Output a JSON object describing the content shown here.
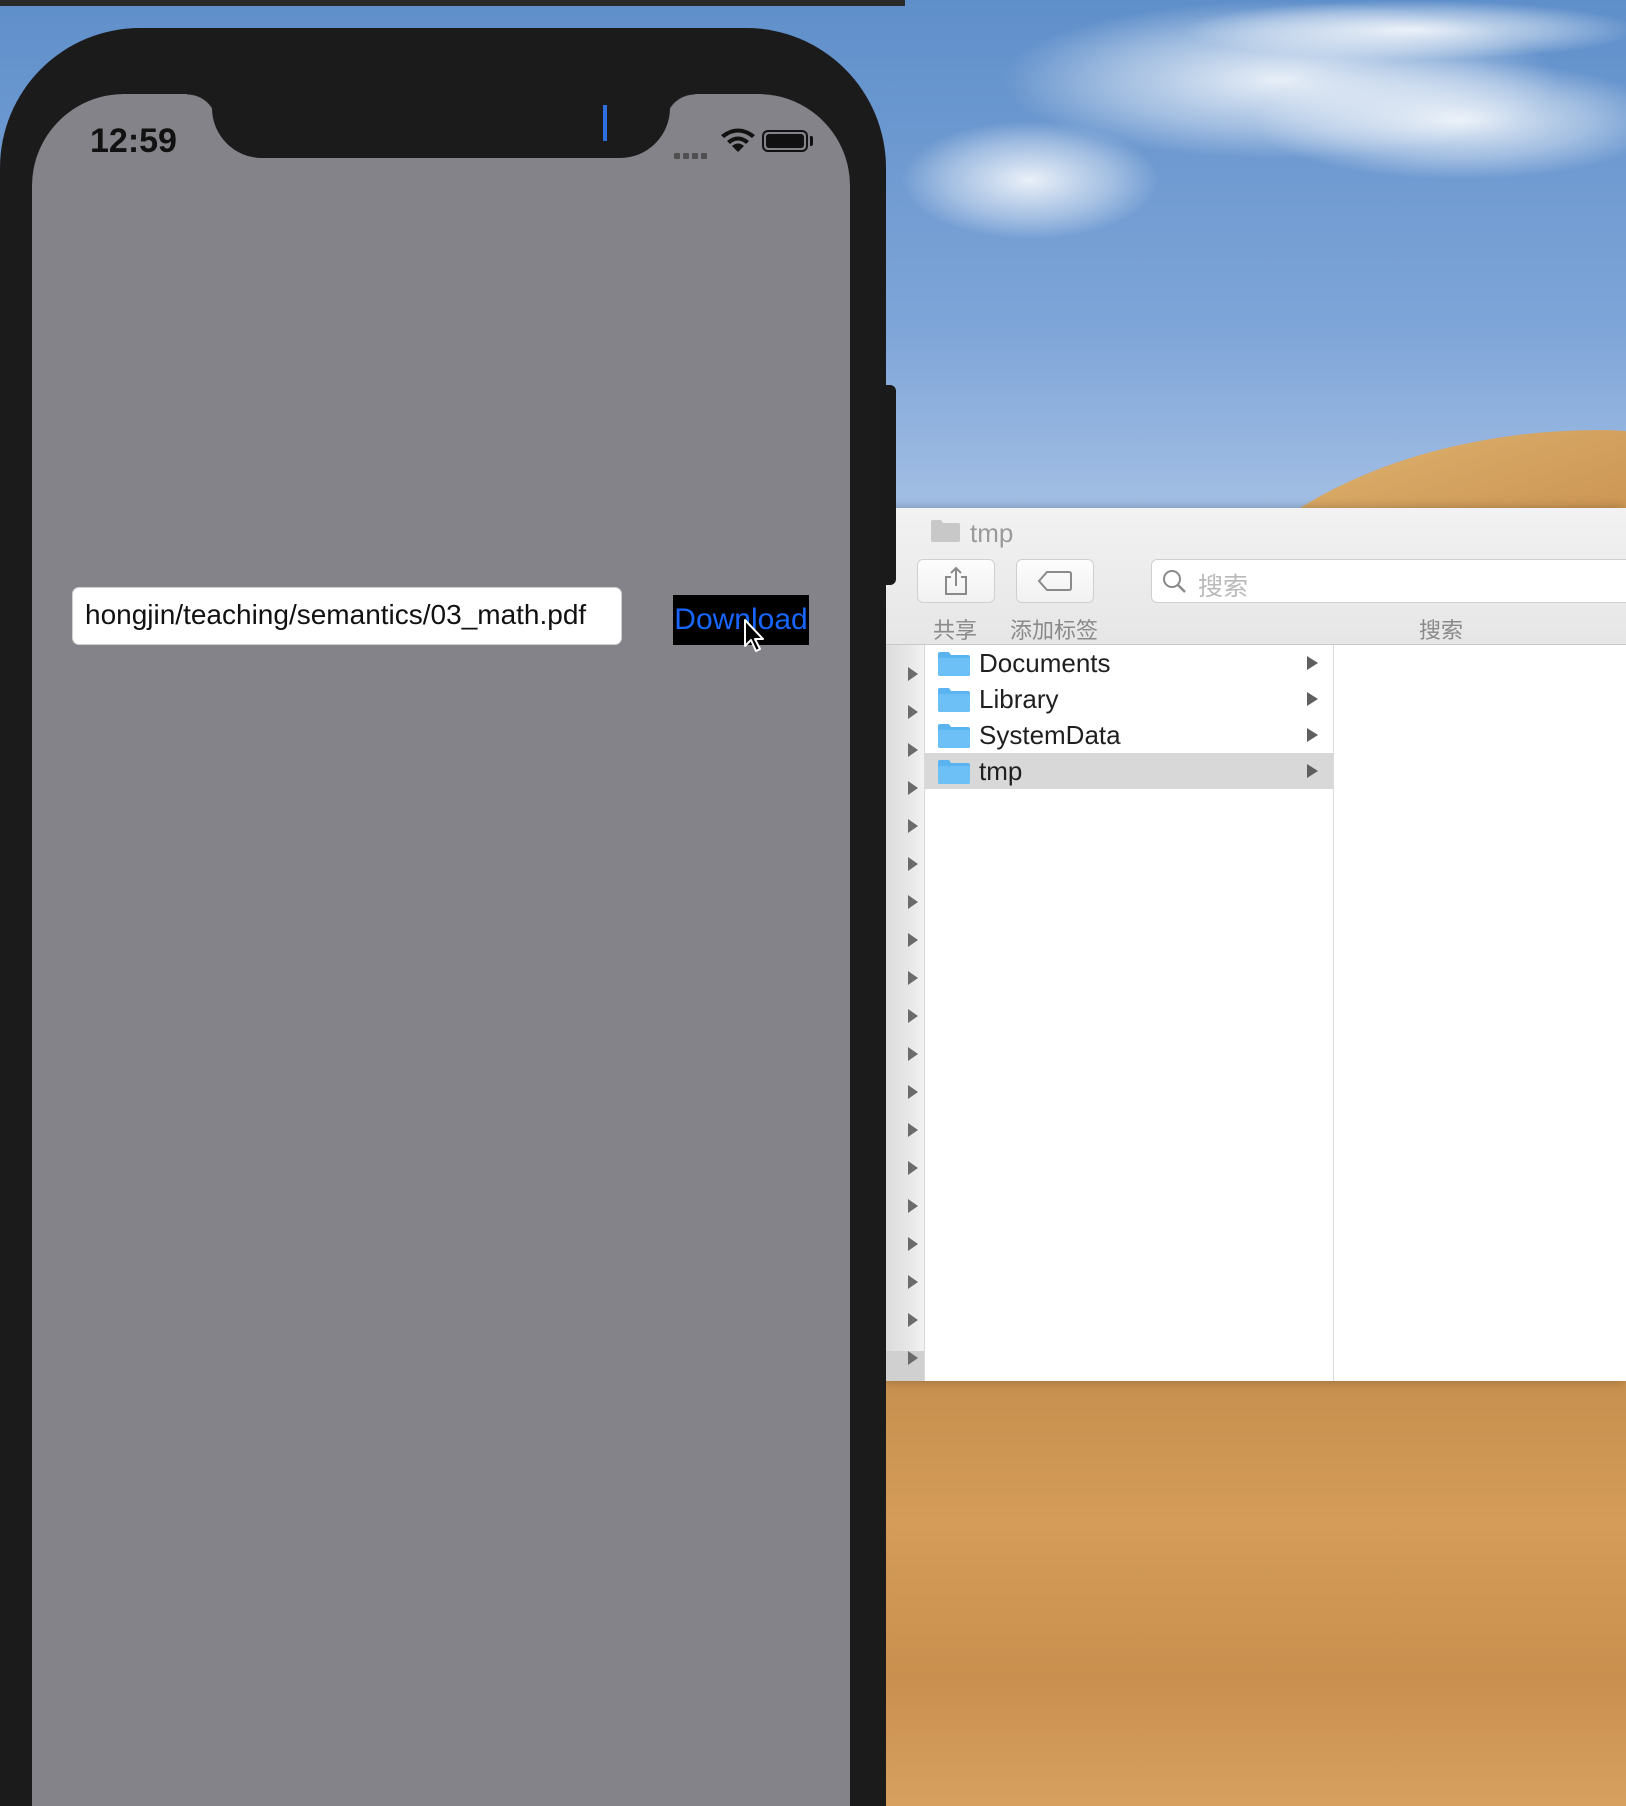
{
  "phone": {
    "status_bar": {
      "time": "12:59"
    },
    "url_field": {
      "value": "hongjin/teaching/semantics/03_math.pdf"
    },
    "download_button": {
      "label": "Download"
    }
  },
  "finder": {
    "title": "tmp",
    "toolbar": {
      "share_label": "共享",
      "tag_label": "添加标签",
      "search_label": "搜索",
      "search_placeholder": "搜索"
    },
    "items": [
      {
        "label": "Documents",
        "selected": false
      },
      {
        "label": "Library",
        "selected": false
      },
      {
        "label": "SystemData",
        "selected": false
      },
      {
        "label": "tmp",
        "selected": true
      }
    ]
  },
  "colors": {
    "button_text": "#1766ff",
    "folder_blue": "#5ab4f0",
    "selection_gray": "#d8d8d8"
  }
}
